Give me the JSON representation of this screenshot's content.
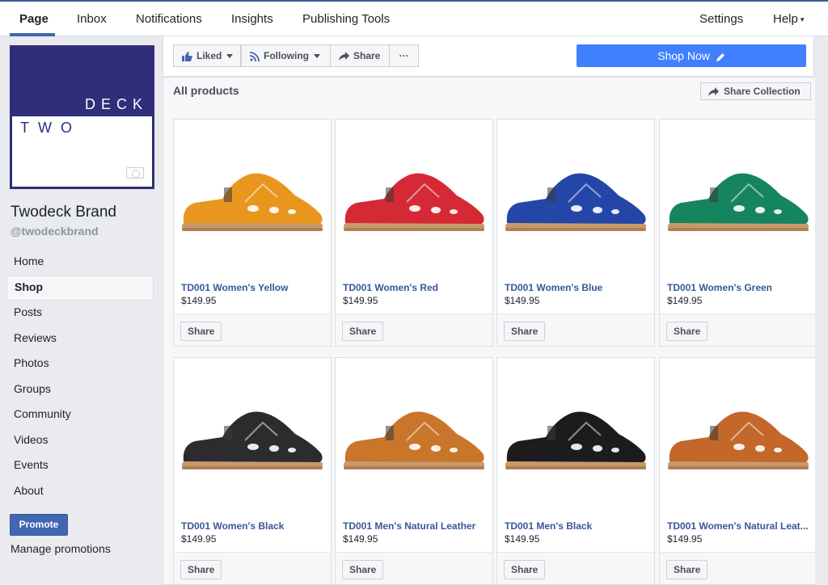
{
  "topnav": {
    "tabs": [
      "Page",
      "Inbox",
      "Notifications",
      "Insights",
      "Publishing Tools"
    ],
    "settings": "Settings",
    "help": "Help",
    "accent": "#4267b2"
  },
  "sidebar": {
    "logo_top": "DECK",
    "logo_bottom": "TWO",
    "page_name": "Twodeck Brand",
    "handle": "@twodeckbrand",
    "items": [
      "Home",
      "Shop",
      "Posts",
      "Reviews",
      "Photos",
      "Groups",
      "Community",
      "Videos",
      "Events",
      "About"
    ],
    "active": "Shop",
    "promote": "Promote",
    "manage": "Manage promotions"
  },
  "actions": {
    "liked": "Liked",
    "following": "Following",
    "share": "Share",
    "more": "···",
    "shop_now": "Shop Now"
  },
  "products_panel": {
    "title": "All products",
    "share_collection": "Share Collection",
    "share_label": "Share",
    "items": [
      {
        "name": "TD001 Women's Yellow",
        "price": "$149.95",
        "color": "#e8961e"
      },
      {
        "name": "TD001 Women's Red",
        "price": "$149.95",
        "color": "#d52a35"
      },
      {
        "name": "TD001 Women's Blue",
        "price": "$149.95",
        "color": "#2446a8"
      },
      {
        "name": "TD001 Women's Green",
        "price": "$149.95",
        "color": "#14855f"
      },
      {
        "name": "TD001 Women's Black",
        "price": "$149.95",
        "color": "#2c2c2e"
      },
      {
        "name": "TD001 Men's Natural Leather",
        "price": "$149.95",
        "color": "#c9752a"
      },
      {
        "name": "TD001 Men's Black",
        "price": "$149.95",
        "color": "#1c1c1e"
      },
      {
        "name": "TD001 Women's Natural Leat...",
        "price": "$149.95",
        "color": "#c4672a"
      }
    ]
  }
}
